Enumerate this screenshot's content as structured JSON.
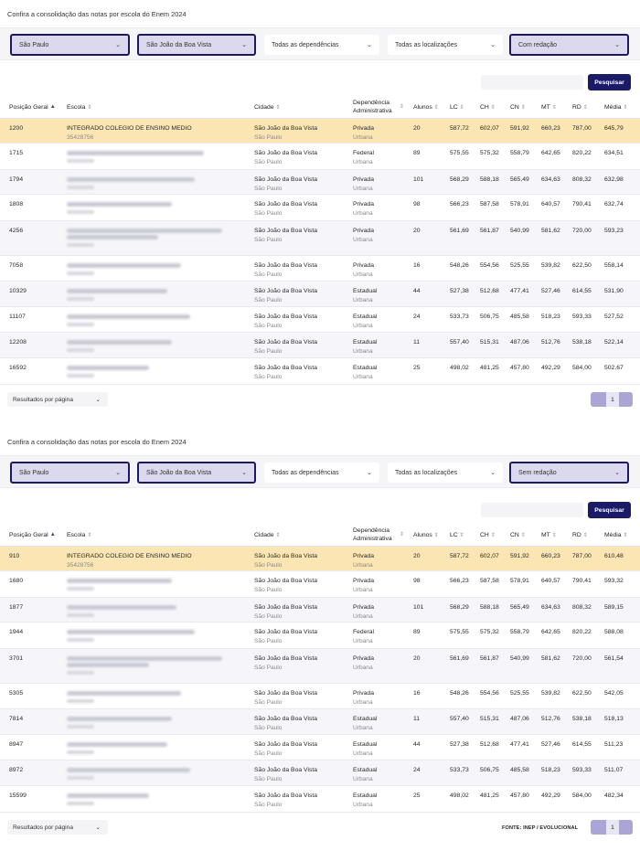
{
  "panels": [
    {
      "title": "Confira a consolidação das notas por escola do Enem 2024",
      "filters": {
        "state": "São Paulo",
        "city": "São João da Boa Vista",
        "dependency": "Todas as dependências",
        "location": "Todas as localizações",
        "essay": "Com redação"
      },
      "search_label": "Pesquisar",
      "columns": [
        "Posição Geral",
        "Escola",
        "Cidade",
        "Dependência Administrativa",
        "Alunos",
        "LC",
        "CH",
        "CN",
        "MT",
        "RD",
        "Média"
      ],
      "rows": [
        {
          "pos": "1200",
          "school": "INTEGRADO COLEGIO DE ENSINO MEDIO",
          "code": "35428756",
          "city": "São João da Boa Vista",
          "state": "São Paulo",
          "dep": "Privada",
          "loc": "Urbana",
          "students": "20",
          "lc": "587,72",
          "ch": "602,07",
          "cn": "591,92",
          "mt": "660,23",
          "rd": "787,00",
          "avg": "645,79"
        },
        {
          "pos": "1715",
          "city": "São João da Boa Vista",
          "state": "São Paulo",
          "dep": "Federal",
          "loc": "Urbana",
          "students": "89",
          "lc": "575,55",
          "ch": "575,32",
          "cn": "558,79",
          "mt": "642,65",
          "rd": "820,22",
          "avg": "634,51"
        },
        {
          "pos": "1794",
          "city": "São João da Boa Vista",
          "state": "São Paulo",
          "dep": "Privada",
          "loc": "Urbana",
          "students": "101",
          "lc": "568,29",
          "ch": "588,18",
          "cn": "565,49",
          "mt": "634,63",
          "rd": "808,32",
          "avg": "632,98"
        },
        {
          "pos": "1808",
          "city": "São João da Boa Vista",
          "state": "São Paulo",
          "dep": "Privada",
          "loc": "Urbana",
          "students": "98",
          "lc": "566,23",
          "ch": "587,58",
          "cn": "578,91",
          "mt": "640,57",
          "rd": "790,41",
          "avg": "632,74"
        },
        {
          "pos": "4256",
          "city": "São João da Boa Vista",
          "state": "São Paulo",
          "dep": "Privada",
          "loc": "Urbana",
          "students": "20",
          "lc": "561,69",
          "ch": "561,87",
          "cn": "540,99",
          "mt": "581,62",
          "rd": "720,00",
          "avg": "593,23"
        },
        {
          "pos": "7058",
          "city": "São João da Boa Vista",
          "state": "São Paulo",
          "dep": "Privada",
          "loc": "Urbana",
          "students": "16",
          "lc": "548,26",
          "ch": "554,56",
          "cn": "525,55",
          "mt": "539,82",
          "rd": "622,50",
          "avg": "558,14"
        },
        {
          "pos": "10329",
          "city": "São João da Boa Vista",
          "state": "São Paulo",
          "dep": "Estadual",
          "loc": "Urbana",
          "students": "44",
          "lc": "527,38",
          "ch": "512,68",
          "cn": "477,41",
          "mt": "527,46",
          "rd": "614,55",
          "avg": "531,90"
        },
        {
          "pos": "11107",
          "city": "São João da Boa Vista",
          "state": "São Paulo",
          "dep": "Estadual",
          "loc": "Urbana",
          "students": "24",
          "lc": "533,73",
          "ch": "506,75",
          "cn": "485,58",
          "mt": "518,23",
          "rd": "593,33",
          "avg": "527,52"
        },
        {
          "pos": "12208",
          "city": "São João da Boa Vista",
          "state": "São Paulo",
          "dep": "Estadual",
          "loc": "Urbana",
          "students": "11",
          "lc": "557,40",
          "ch": "515,31",
          "cn": "487,06",
          "mt": "512,76",
          "rd": "538,18",
          "avg": "522,14"
        },
        {
          "pos": "16592",
          "city": "São João da Boa Vista",
          "state": "São Paulo",
          "dep": "Estadual",
          "loc": "Urbana",
          "students": "25",
          "lc": "498,02",
          "ch": "481,25",
          "cn": "457,80",
          "mt": "492,29",
          "rd": "584,00",
          "avg": "502,67"
        }
      ],
      "per_page_label": "Resultados por página",
      "page": "1"
    },
    {
      "title": "Confira a consolidação das notas por escola do Enem 2024",
      "filters": {
        "state": "São Paulo",
        "city": "São João da Boa Vista",
        "dependency": "Todas as dependências",
        "location": "Todas as localizações",
        "essay": "Sem redação"
      },
      "search_label": "Pesquisar",
      "columns": [
        "Posição Geral",
        "Escola",
        "Cidade",
        "Dependência Administrativa",
        "Alunos",
        "LC",
        "CH",
        "CN",
        "MT",
        "RD",
        "Média"
      ],
      "rows": [
        {
          "pos": "910",
          "school": "INTEGRADO COLEGIO DE ENSINO MEDIO",
          "code": "35428756",
          "city": "São João da Boa Vista",
          "state": "São Paulo",
          "dep": "Privada",
          "loc": "Urbana",
          "students": "20",
          "lc": "587,72",
          "ch": "602,07",
          "cn": "591,92",
          "mt": "660,23",
          "rd": "787,00",
          "avg": "610,48"
        },
        {
          "pos": "1680",
          "city": "São João da Boa Vista",
          "state": "São Paulo",
          "dep": "Privada",
          "loc": "Urbana",
          "students": "98",
          "lc": "566,23",
          "ch": "587,58",
          "cn": "578,91",
          "mt": "640,57",
          "rd": "790,41",
          "avg": "593,32"
        },
        {
          "pos": "1877",
          "city": "São João da Boa Vista",
          "state": "São Paulo",
          "dep": "Privada",
          "loc": "Urbana",
          "students": "101",
          "lc": "568,29",
          "ch": "588,18",
          "cn": "565,49",
          "mt": "634,63",
          "rd": "808,32",
          "avg": "589,15"
        },
        {
          "pos": "1944",
          "city": "São João da Boa Vista",
          "state": "São Paulo",
          "dep": "Federal",
          "loc": "Urbana",
          "students": "89",
          "lc": "575,55",
          "ch": "575,32",
          "cn": "558,79",
          "mt": "642,65",
          "rd": "820,22",
          "avg": "588,08"
        },
        {
          "pos": "3701",
          "city": "São João da Boa Vista",
          "state": "São Paulo",
          "dep": "Privada",
          "loc": "Urbana",
          "students": "20",
          "lc": "561,69",
          "ch": "561,87",
          "cn": "540,99",
          "mt": "581,62",
          "rd": "720,00",
          "avg": "561,54"
        },
        {
          "pos": "5305",
          "city": "São João da Boa Vista",
          "state": "São Paulo",
          "dep": "Privada",
          "loc": "Urbana",
          "students": "16",
          "lc": "548,26",
          "ch": "554,56",
          "cn": "525,55",
          "mt": "539,82",
          "rd": "622,50",
          "avg": "542,05"
        },
        {
          "pos": "7814",
          "city": "São João da Boa Vista",
          "state": "São Paulo",
          "dep": "Estadual",
          "loc": "Urbana",
          "students": "11",
          "lc": "557,40",
          "ch": "515,31",
          "cn": "487,06",
          "mt": "512,76",
          "rd": "538,18",
          "avg": "518,13"
        },
        {
          "pos": "8947",
          "city": "São João da Boa Vista",
          "state": "São Paulo",
          "dep": "Estadual",
          "loc": "Urbana",
          "students": "44",
          "lc": "527,38",
          "ch": "512,68",
          "cn": "477,41",
          "mt": "527,46",
          "rd": "614,55",
          "avg": "511,23"
        },
        {
          "pos": "8972",
          "city": "São João da Boa Vista",
          "state": "São Paulo",
          "dep": "Estadual",
          "loc": "Urbana",
          "students": "24",
          "lc": "533,73",
          "ch": "506,75",
          "cn": "485,58",
          "mt": "518,23",
          "rd": "593,33",
          "avg": "511,07"
        },
        {
          "pos": "15599",
          "city": "São João da Boa Vista",
          "state": "São Paulo",
          "dep": "Estadual",
          "loc": "Urbana",
          "students": "25",
          "lc": "498,02",
          "ch": "481,25",
          "cn": "457,80",
          "mt": "492,29",
          "rd": "584,00",
          "avg": "482,34"
        }
      ],
      "per_page_label": "Resultados por página",
      "page": "1",
      "source": "FONTE: INEP / EVOLUCIONAL"
    }
  ]
}
